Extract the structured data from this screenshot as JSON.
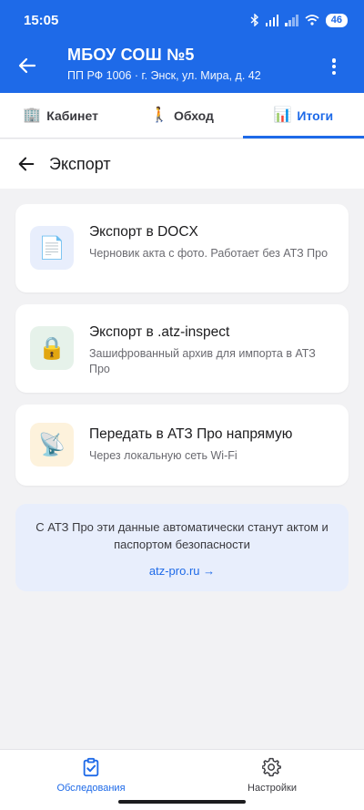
{
  "status": {
    "time": "15:05",
    "battery": "46"
  },
  "header": {
    "title": "МБОУ СОШ №5",
    "subtitle": "ПП РФ 1006 · г. Энск, ул. Мира, д. 42"
  },
  "tabs": [
    {
      "icon": "🏢",
      "label": "Кабинет"
    },
    {
      "icon": "🚶",
      "label": "Обход"
    },
    {
      "icon": "📊",
      "label": "Итоги",
      "active": true
    }
  ],
  "page": {
    "title": "Экспорт"
  },
  "options": [
    {
      "icon": "📄",
      "icon_name": "document-icon",
      "title": "Экспорт в DOCX",
      "desc": "Черновик акта с фото. Работает без АТЗ Про",
      "icon_bg": "#e8eefc"
    },
    {
      "icon": "🔒",
      "icon_name": "lock-icon",
      "title": "Экспорт в .atz-inspect",
      "desc": "Зашифрованный архив для импорта в АТЗ Про",
      "icon_bg": "#e6f2ea"
    },
    {
      "icon": "📡",
      "icon_name": "satellite-dish-icon",
      "title": "Передать в АТЗ Про напрямую",
      "desc": "Через локальную сеть Wi-Fi",
      "icon_bg": "#fdf2dc"
    }
  ],
  "info": {
    "message": "С АТЗ Про эти данные автоматически станут актом и паспортом безопасности",
    "link": "atz-pro.ru →"
  },
  "bottom_nav": [
    {
      "label": "Обследования",
      "active": true
    },
    {
      "label": "Настройки"
    }
  ],
  "colors": {
    "primary": "#1e6ae8",
    "background": "#f2f2f4"
  }
}
